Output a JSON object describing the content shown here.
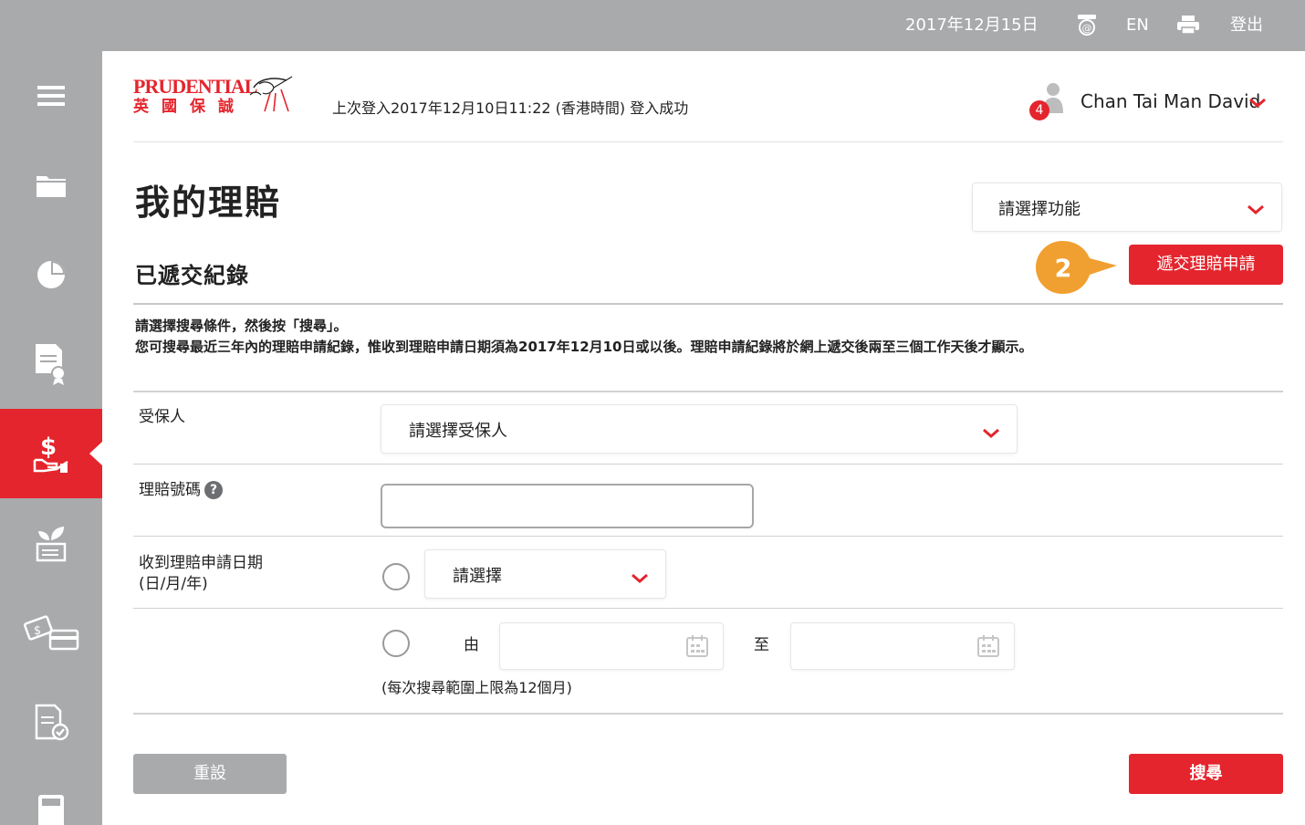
{
  "topbar": {
    "date": "2017年12月15日",
    "contact_icon": "contact-at-icon",
    "lang": "EN",
    "print_icon": "print-icon",
    "logout": "登出"
  },
  "sidebar": {
    "items": [
      {
        "icon": "menu-icon"
      },
      {
        "icon": "folder-icon"
      },
      {
        "icon": "pie-chart-icon"
      },
      {
        "icon": "certificate-icon"
      },
      {
        "icon": "claims-money-hand-icon",
        "active": true
      },
      {
        "icon": "plant-growth-icon"
      },
      {
        "icon": "payment-card-icon"
      },
      {
        "icon": "document-check-icon"
      },
      {
        "icon": "calculator-icon"
      }
    ]
  },
  "header": {
    "logo_en": "PRUDENTIAL",
    "logo_zh": "英國保誠",
    "last_login": "上次登入2017年12月10日11:22 (香港時間) 登入成功",
    "notification_count": "4",
    "user_name": "Chan Tai Man David"
  },
  "page": {
    "title": "我的理賠",
    "function_select": "請選擇功能",
    "step_number": "2",
    "submit_claim_button": "遞交理賠申請",
    "section_title": "已遞交紀錄",
    "instruction_1": "請選擇搜尋條件，然後按「搜尋」。",
    "instruction_2": "您可搜尋最近三年內的理賠申請紀錄，惟收到理賠申請日期須為2017年12月10日或以後。理賠申請紀錄將於網上遞交後兩至三個工作天後才顯示。"
  },
  "form": {
    "insured_label": "受保人",
    "insured_select": "請選擇受保人",
    "claim_no_label": "理賠號碼",
    "claim_no_value": "",
    "date_label_1": "收到理賠申請日期",
    "date_label_2": "(日/月/年)",
    "date_select": "請選擇",
    "from_label": "由",
    "to_label": "至",
    "range_note": "(每次搜尋範圍上限為12個月)",
    "reset_button": "重設",
    "search_button": "搜尋"
  },
  "colors": {
    "brand_red": "#e4252d",
    "step_orange": "#f0a030",
    "sidebar_grey": "#a9aaac"
  }
}
